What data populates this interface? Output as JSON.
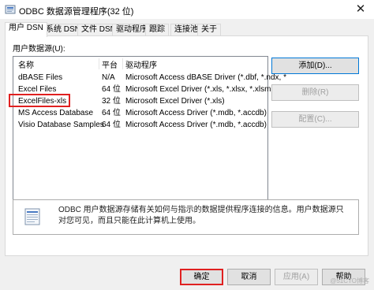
{
  "window": {
    "title": "ODBC 数据源管理程序(32 位)",
    "close_glyph": "✕"
  },
  "tabs": [
    {
      "label": "用户 DSN",
      "active": true
    },
    {
      "label": "系统 DSN",
      "active": false
    },
    {
      "label": "文件 DSN",
      "active": false
    },
    {
      "label": "驱动程序",
      "active": false
    },
    {
      "label": "跟踪",
      "active": false
    },
    {
      "label": "连接池",
      "active": false
    },
    {
      "label": "关于",
      "active": false
    }
  ],
  "user_dsn": {
    "section_label": "用户数据源(U):",
    "columns": {
      "name": "名称",
      "platform": "平台",
      "driver": "驱动程序"
    },
    "rows": [
      {
        "name": "dBASE Files",
        "platform": "N/A",
        "driver": "Microsoft Access dBASE Driver (*.dbf, *.ndx, *"
      },
      {
        "name": "Excel Files",
        "platform": "64 位",
        "driver": "Microsoft Excel Driver (*.xls, *.xlsx, *.xlsm, *.xl"
      },
      {
        "name": "ExcelFiles-xls",
        "platform": "32 位",
        "driver": "Microsoft Excel Driver (*.xls)"
      },
      {
        "name": "MS Access Database",
        "platform": "64 位",
        "driver": "Microsoft Access Driver (*.mdb, *.accdb)"
      },
      {
        "name": "Visio Database Samples",
        "platform": "64 位",
        "driver": "Microsoft Access Driver (*.mdb, *.accdb)"
      }
    ],
    "buttons": {
      "add": "添加(D)...",
      "remove": "删除(R)",
      "configure": "配置(C)..."
    },
    "info_text": "ODBC 用户数据源存储有关如何与指示的数据提供程序连接的信息。用户数据源只对您可见，而且只能在此计算机上使用。"
  },
  "footer": {
    "ok": "确定",
    "cancel": "取消",
    "apply": "应用(A)",
    "help": "帮助"
  },
  "watermark": "@51CTO博客"
}
